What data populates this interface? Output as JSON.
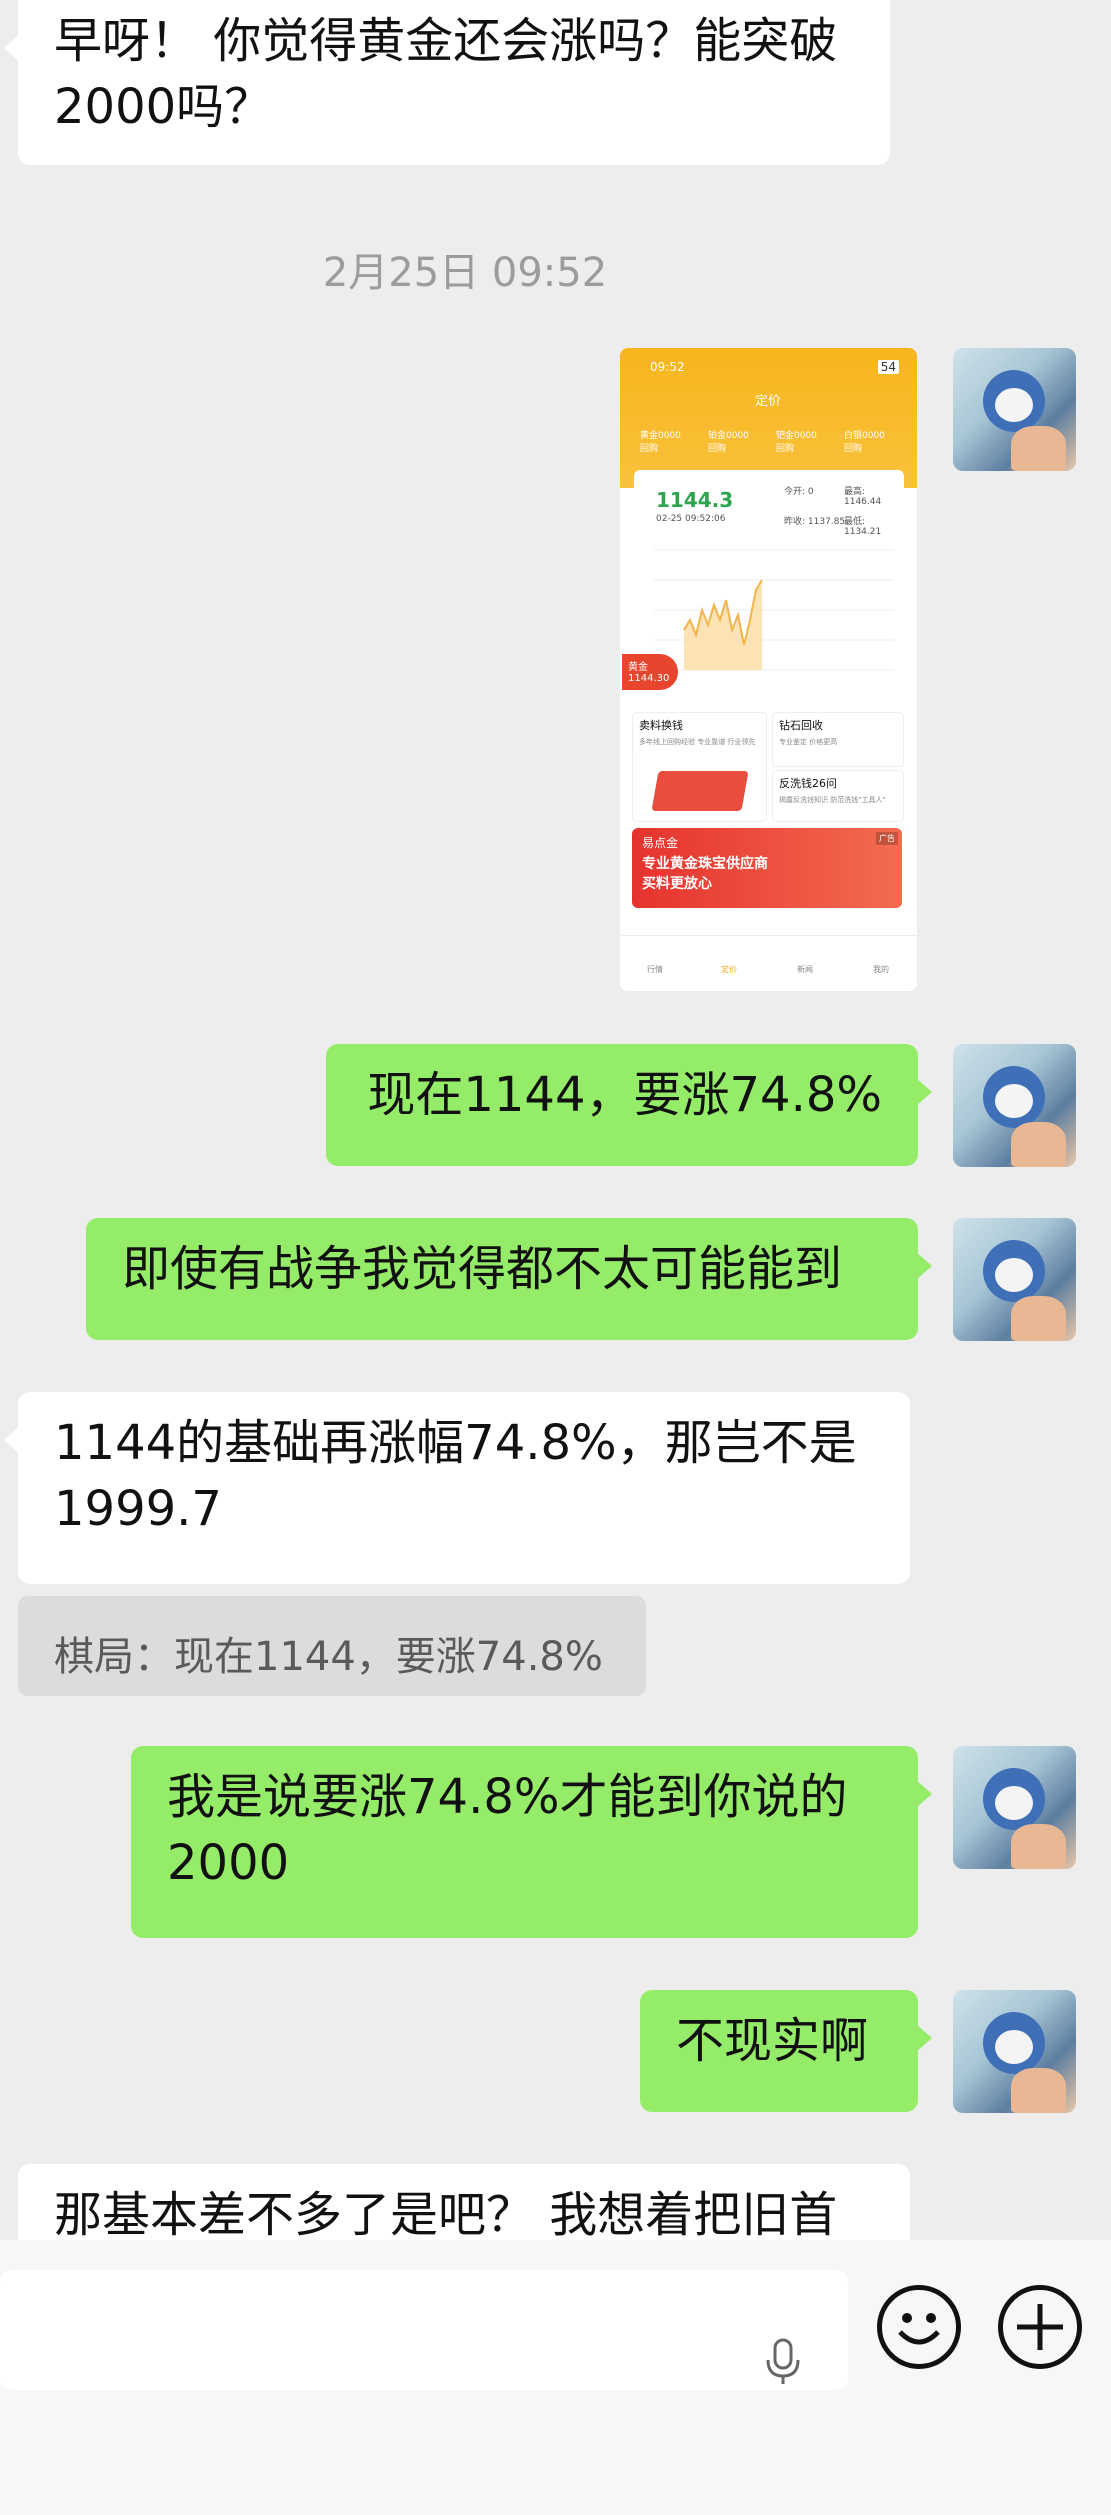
{
  "messages": [
    {
      "side": "in",
      "text": "早呀！ 你觉得黄金还会涨吗？能突破2000吗？"
    },
    {
      "side": "out",
      "text": "现在1144，要涨74.8%"
    },
    {
      "side": "out",
      "text": "即使有战争我觉得都不太可能能到"
    },
    {
      "side": "in",
      "text": "1144的基础再涨幅74.8%，那岂不是1999.7"
    },
    {
      "side": "out",
      "text": "我是说要涨74.8%才能到你说的2000"
    },
    {
      "side": "out",
      "text": "不现实啊"
    },
    {
      "side": "in",
      "text": "那基本差不多了是吧？ 我想着把旧首"
    }
  ],
  "timestamp": "2月25日 09:52",
  "quote": "棋局：现在1144，要涨74.8%",
  "screenshot": {
    "status_time": "09:52",
    "battery": "54",
    "title": "定价",
    "metals": [
      "黄金0000 回购",
      "铂金0000 回购",
      "钯金0000 回购",
      "白银0000 回购"
    ],
    "price": "1144.3",
    "datetime": "02-25 09:52:06",
    "open": "今开: 0",
    "high": "最高: 1146.44",
    "prev_close": "昨收: 1137.85",
    "low": "最低: 1134.21",
    "tag_label": "黄金",
    "tag_price": "1144.30",
    "tile1_title": "卖料换钱",
    "tile1_sub": "多年线上回购经验 专业靠谱 行业领先",
    "tile2_title": "钻石回收",
    "tile2_sub": "专业鉴定 价格更高",
    "tile3_title": "反洗钱26问",
    "tile3_sub": "揭露反洗钱知识 防范洗钱\"工具人\"",
    "banner_brand": "易点金",
    "banner_line1": "专业黄金珠宝供应商",
    "banner_line2": "买料更放心",
    "ad_tag": "广告",
    "tabs": [
      "行情",
      "定价",
      "新闻",
      "我的"
    ]
  },
  "colors": {
    "background": "#ededed",
    "incoming_bubble": "#ffffff",
    "outgoing_bubble": "#95ec69",
    "chart_line": "#f2b44c"
  },
  "icons": {
    "mic": "microphone-icon",
    "emoji": "smiley-icon",
    "plus": "plus-circle-icon"
  }
}
